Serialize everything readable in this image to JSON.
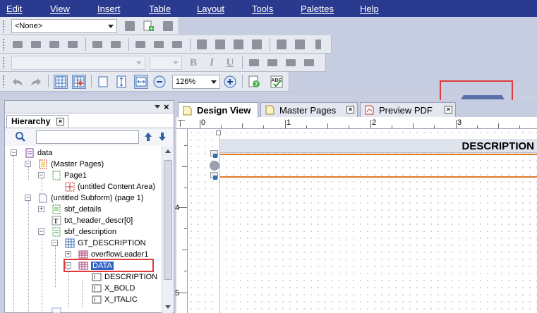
{
  "menu": [
    "Edit",
    "View",
    "Insert",
    "Table",
    "Layout",
    "Tools",
    "Palettes",
    "Help"
  ],
  "toolbar": {
    "style_select": "<None>",
    "font_select": "",
    "font_size_select": "",
    "bold": "B",
    "italic": "I",
    "underline": "U",
    "zoom": "126%"
  },
  "hierarchy": {
    "panel_title": "Hierarchy",
    "search_placeholder": "",
    "nodes": [
      {
        "label": "data"
      },
      {
        "label": "(Master Pages)"
      },
      {
        "label": "Page1"
      },
      {
        "label": "(untitled Content Area)"
      },
      {
        "label": "(untitled Subform) (page 1)"
      },
      {
        "label": "sbf_details"
      },
      {
        "label": "txt_header_descr[0]"
      },
      {
        "label": "sbf_description"
      },
      {
        "label": "GT_DESCRIPTION"
      },
      {
        "label": "overflowLeader1"
      },
      {
        "label": "DATA"
      },
      {
        "label": "DESCRIPTION"
      },
      {
        "label": "X_BOLD"
      },
      {
        "label": "X_ITALIC"
      }
    ]
  },
  "tabs": [
    {
      "label": "Design View"
    },
    {
      "label": "Master Pages"
    },
    {
      "label": "Preview PDF"
    }
  ],
  "ruler": {
    "top": [
      "0",
      "1",
      "2",
      "3"
    ],
    "left": [
      "4",
      "5"
    ]
  },
  "canvas": {
    "header_text": "DESCRIPTION"
  },
  "colors": {
    "menubar": "#2a3a8f",
    "highlight": "#e03a3a",
    "selection": "#3162c5",
    "orange_line": "#e07b2a"
  }
}
